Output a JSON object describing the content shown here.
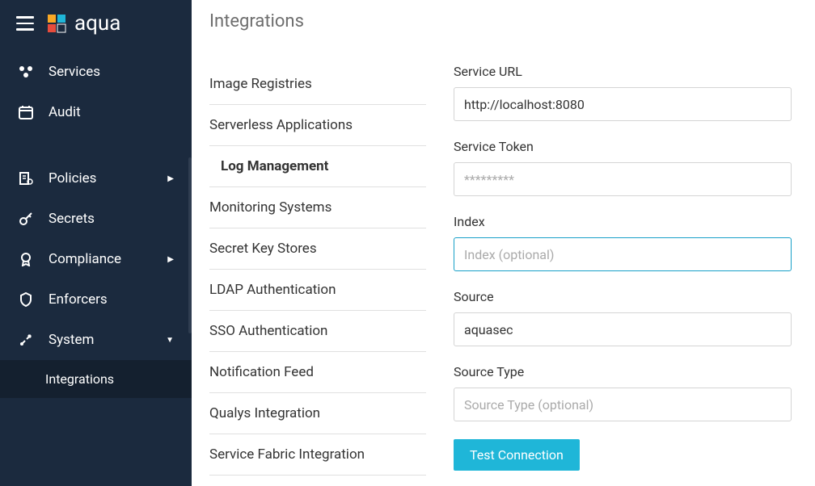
{
  "brand": "aqua",
  "nav": {
    "services": "Services",
    "audit": "Audit",
    "policies": "Policies",
    "secrets": "Secrets",
    "compliance": "Compliance",
    "enforcers": "Enforcers",
    "system": "System",
    "integrations": "Integrations"
  },
  "page_title": "Integrations",
  "sublist": {
    "image_registries": "Image Registries",
    "serverless_applications": "Serverless Applications",
    "log_management": "Log Management",
    "monitoring_systems": "Monitoring Systems",
    "secret_key_stores": "Secret Key Stores",
    "ldap_authentication": "LDAP Authentication",
    "sso_authentication": "SSO Authentication",
    "notification_feed": "Notification Feed",
    "qualys_integration": "Qualys Integration",
    "service_fabric_integration": "Service Fabric Integration"
  },
  "form": {
    "service_url": {
      "label": "Service URL",
      "value": "http://localhost:8080"
    },
    "service_token": {
      "label": "Service Token",
      "value": "",
      "placeholder": "*********"
    },
    "index": {
      "label": "Index",
      "value": "",
      "placeholder": "Index (optional)"
    },
    "source": {
      "label": "Source",
      "value": "aquasec"
    },
    "source_type": {
      "label": "Source Type",
      "value": "",
      "placeholder": "Source Type (optional)"
    },
    "test_connection": "Test Connection"
  }
}
